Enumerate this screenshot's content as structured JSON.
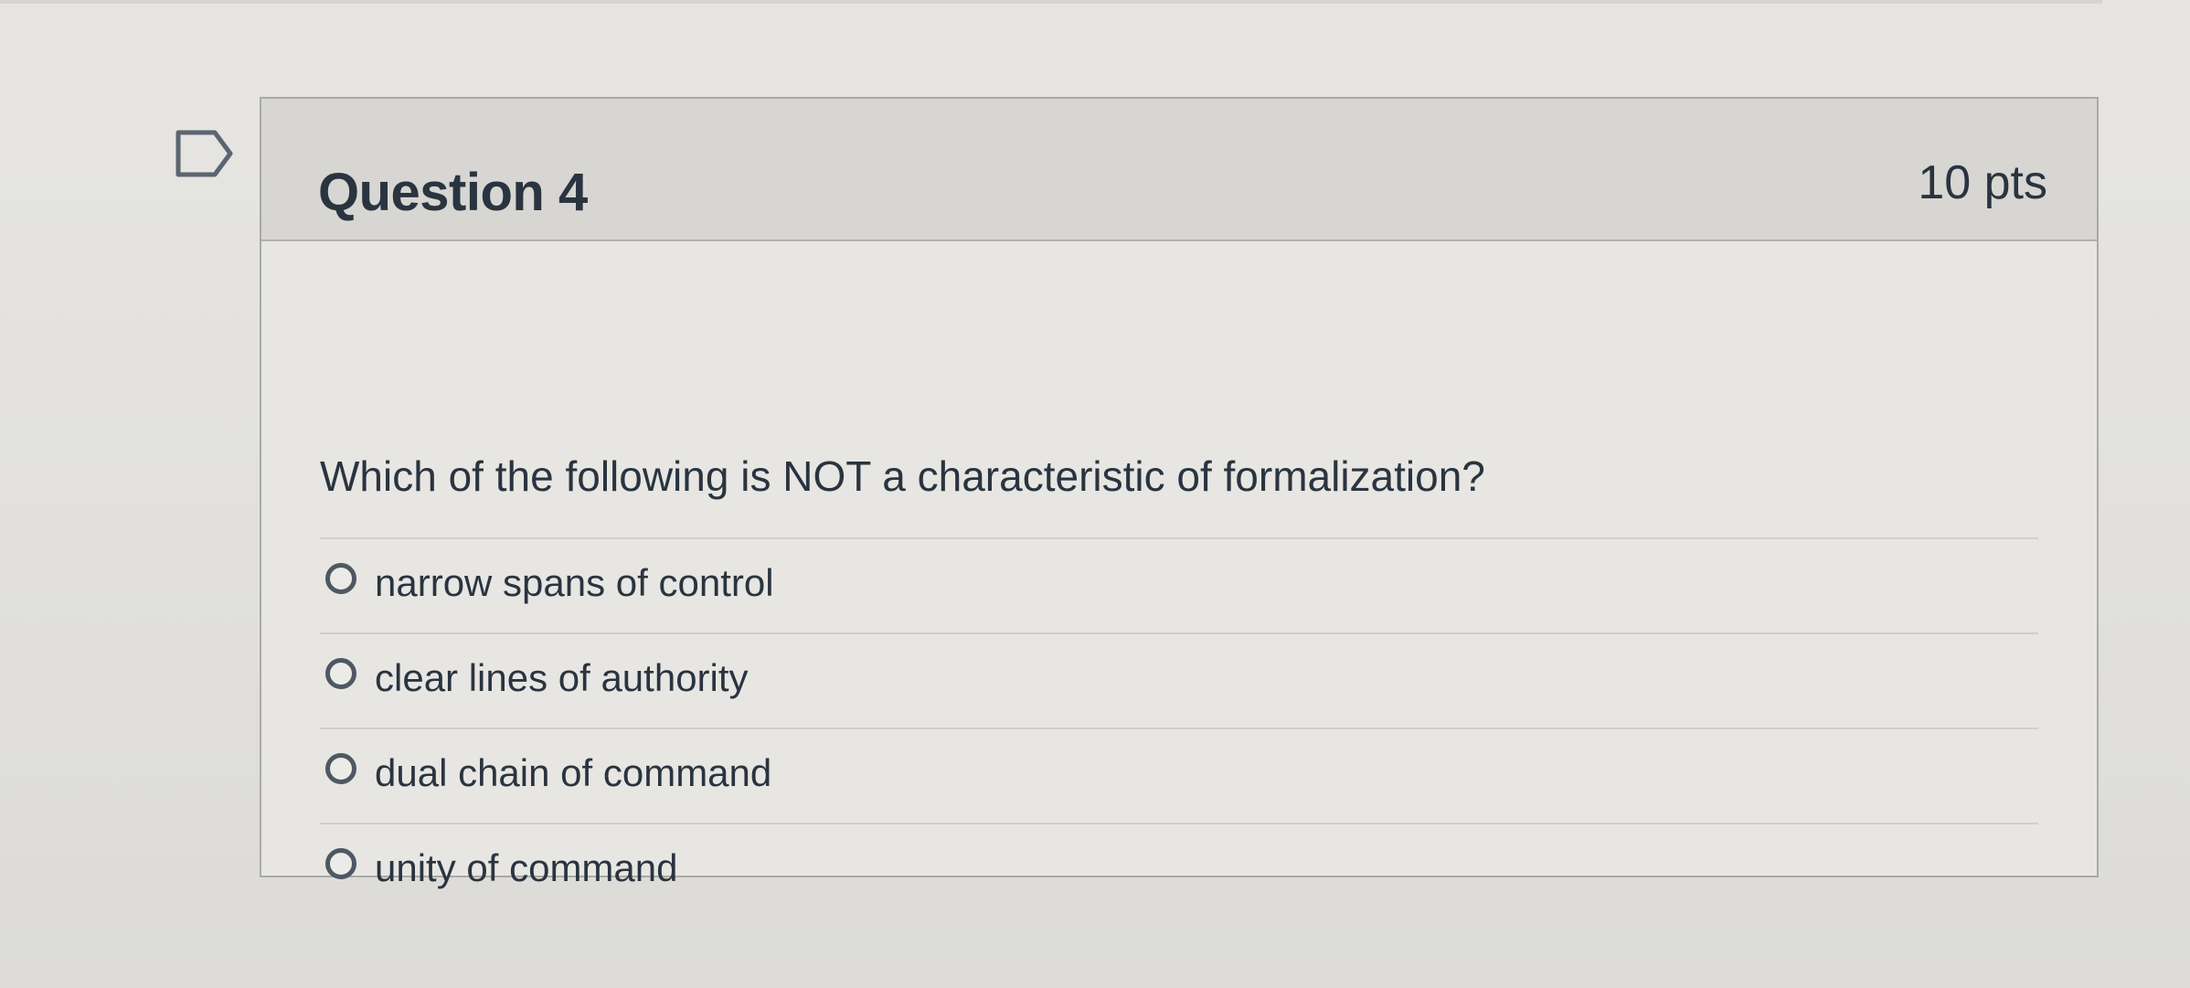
{
  "question": {
    "flag_icon": "bookmark-flag-icon",
    "title": "Question 4",
    "points": "10 pts",
    "text": "Which of the following is NOT a characteristic of formalization?",
    "answers": [
      {
        "label": "narrow spans of control",
        "selected": false
      },
      {
        "label": "clear lines of authority",
        "selected": false
      },
      {
        "label": "dual chain of command",
        "selected": false
      },
      {
        "label": "unity of command",
        "selected": false
      }
    ]
  },
  "colors": {
    "page_background": "#e3e2df",
    "card_header": "#d7d6d2",
    "card_border": "#a9aaa6",
    "text": "#2a3440",
    "radio_border": "#4e5862"
  }
}
